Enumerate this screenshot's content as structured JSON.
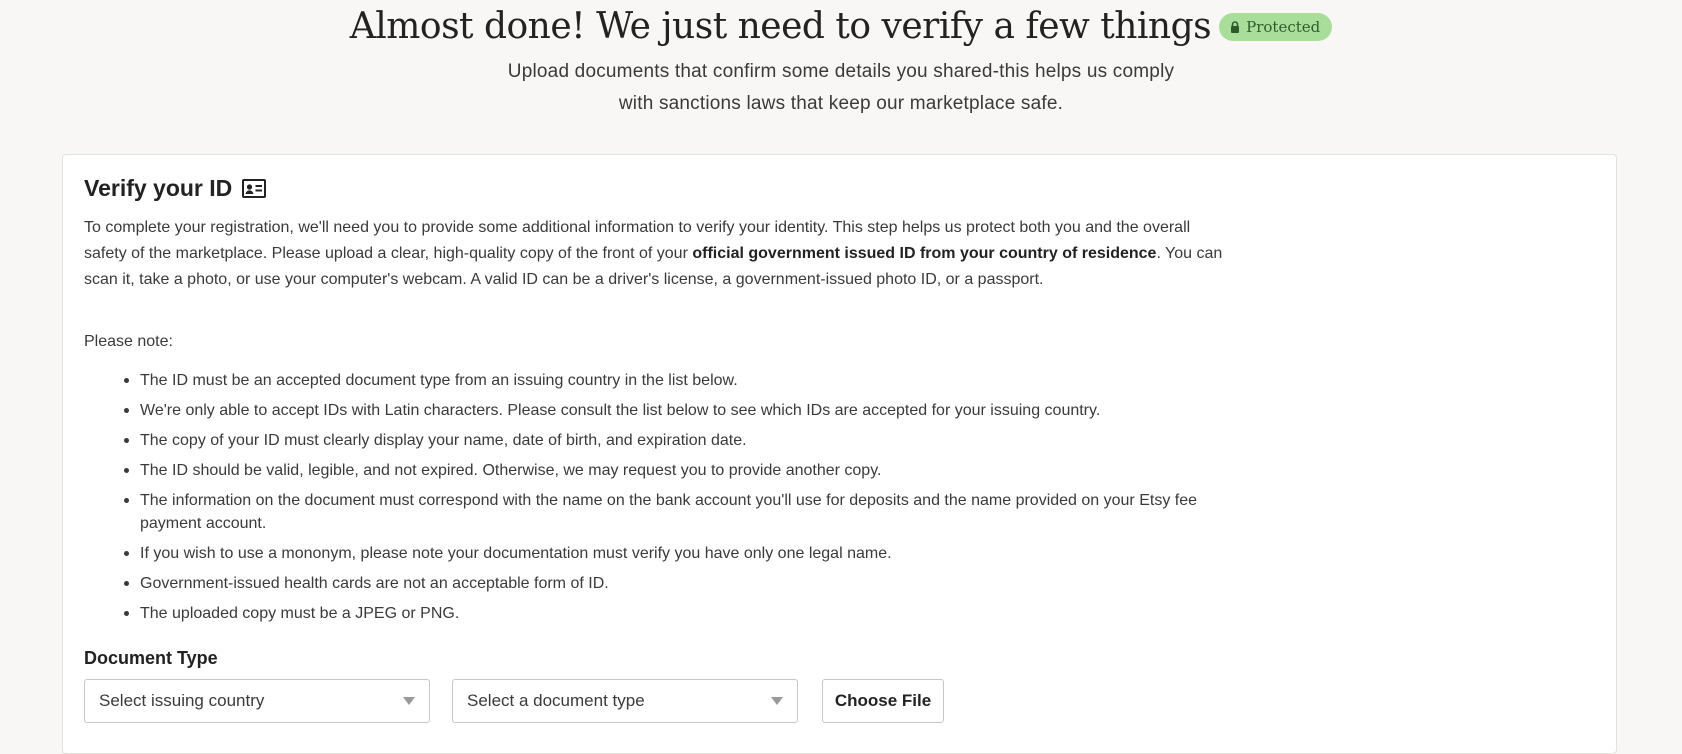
{
  "header": {
    "title": "Almost done! We just need to verify a few things",
    "badge_label": "Protected",
    "subtitle_line1": "Upload documents that confirm some details you shared-this helps us comply",
    "subtitle_line2": "with sanctions laws that keep our marketplace safe."
  },
  "verify": {
    "title": "Verify your ID",
    "intro_part1": "To complete your registration, we'll need you to provide some additional information to verify your identity. This step helps us protect both you and the overall safety of the marketplace. Please upload a clear, high-quality copy of the front of your ",
    "intro_bold": "official government issued ID from your country of residence",
    "intro_part2": ". You can scan it, take a photo, or use your computer's webcam. A valid ID can be a driver's license, a government-issued photo ID, or a passport.",
    "note_label": "Please note:",
    "rules": [
      "The ID must be an accepted document type from an issuing country in the list below.",
      "We're only able to accept IDs with Latin characters. Please consult the list below to see which IDs are accepted for your issuing country.",
      "The copy of your ID must clearly display your name, date of birth, and expiration date.",
      "The ID should be valid, legible, and not expired. Otherwise, we may request you to provide another copy.",
      "The information on the document must correspond with the name on the bank account you'll use for deposits and the name provided on your Etsy fee payment account.",
      "If you wish to use a mononym, please note your documentation must verify you have only one legal name.",
      "Government-issued health cards are not an acceptable form of ID.",
      "The uploaded copy must be a JPEG or PNG."
    ]
  },
  "document": {
    "label": "Document Type",
    "country_select": "Select issuing country",
    "type_select": "Select a document type",
    "choose_file": "Choose File"
  },
  "colors": {
    "background": "#f8f7f5",
    "badge": "#a9de9a",
    "card": "#ffffff"
  },
  "icons": {
    "badge": "lock-icon",
    "title": "id-card-icon",
    "select": "chevron-down-icon"
  }
}
